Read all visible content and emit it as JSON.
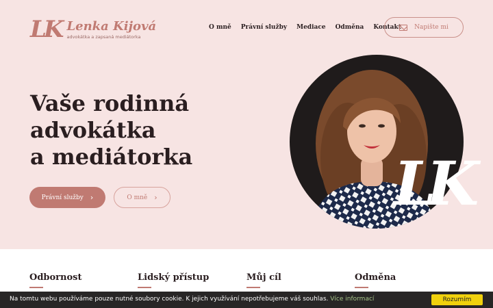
{
  "header": {
    "logo_mark": "LK",
    "logo_name": "Lenka Kijová",
    "logo_subtitle": "advokátka a zapsaná mediátorka",
    "nav": [
      "O mně",
      "Právní služby",
      "Mediace",
      "Odměna",
      "Kontakt"
    ],
    "write_label": "Napište mi",
    "write_icon": "envelope-icon"
  },
  "hero": {
    "headline": [
      "Vaše rodinná",
      "advokátka",
      "a mediátorka"
    ],
    "primary_button": "Právní služby",
    "secondary_button": "O mně",
    "watermark": "LK"
  },
  "features": [
    "Odbornost",
    "Lidský přístup",
    "Můj cíl",
    "Odměna"
  ],
  "cookie": {
    "text": "Na tomtu webu používáme pouze nutné soubory cookie. K jejich využívání nepotřebujeme váš souhlas.",
    "link": "Více informací",
    "button": "Rozumím"
  },
  "colors": {
    "accent": "#c07a72",
    "hero_bg": "#f7e4e3",
    "text_dark": "#2a1e20",
    "cookie_button": "#f1d10d"
  }
}
